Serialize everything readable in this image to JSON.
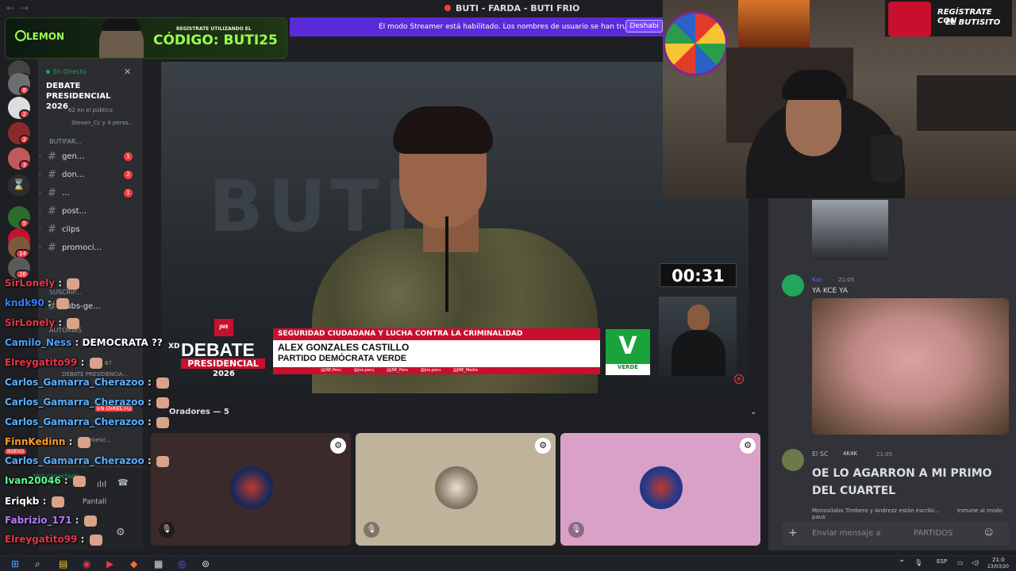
{
  "window": {
    "title": "BUTI - FARDA - BUTI FRIO"
  },
  "banner": {
    "brand": "LEMON",
    "small_text": "REGÍSTRATE UTILIZANDO EL",
    "code": "CÓDIGO: BUTI25"
  },
  "streamer_bar": {
    "text": "El modo Streamer está habilitado. Los nombres de usuario se han truncado.",
    "button": "Deshabi"
  },
  "servers": [
    {
      "badge": "4"
    },
    {
      "badge": "8"
    },
    {
      "badge": "2"
    },
    {
      "badge": "2"
    },
    {
      "badge": "3"
    },
    {
      "badge": ""
    },
    {
      "badge": "5"
    },
    {
      "badge": "4"
    },
    {
      "badge": "14"
    },
    {
      "badge": "26"
    }
  ],
  "sidebar": {
    "live_label": "En Directo",
    "event_title": "DEBATE PRESIDENCIAL 2026",
    "audience": "62 en el público",
    "friends": "Steven_Cc y 4 perso...",
    "category1": "BUTIFAR...",
    "channels": [
      {
        "name": "gen...",
        "count": "1"
      },
      {
        "name": "don...",
        "count": "2"
      },
      {
        "name": "...",
        "count": "1"
      },
      {
        "name": "post...",
        "count": ""
      },
      {
        "name": "clips",
        "count": ""
      },
      {
        "name": "promoci...",
        "count": ""
      }
    ],
    "category2": "SUSCRIP...",
    "channel_subs": "subs-ge...",
    "category3": "AUTORIAS",
    "stage_title": "DEBATE PRESIDENCIA...",
    "live_badge": "EN DIRECTO",
    "new_badge": "NUEVO",
    "voice_connected": "Voz conectada",
    "screen_btn": "Pantall",
    "stage_count": "67",
    "user_short": "onkelvi..."
  },
  "video": {
    "clock": "00:31",
    "topic": "SEGURIDAD CIUDADANA Y LUCHA CONTRA LA CRIMINALIDAD",
    "candidate": "ALEX GONZALES CASTILLO",
    "party": "PARTIDO DEMÓCRATA VERDE",
    "socials": "@JNE.Peru @jne.peru @JNE_Peru @jne.peru @JNE_Media",
    "logo_debate": "DEBATE",
    "logo_presidencial": "PRESIDENCIAL",
    "logo_year": "2026",
    "xd": "XD",
    "jne": "JNE",
    "party_letter": "V",
    "party_name": "VERDE",
    "bg_text": "BUTI1"
  },
  "speakers": {
    "header": "Oradores — 5"
  },
  "webcam": {
    "line1": "REGÍSTRATE CON",
    "line2": "EL BUTISITO"
  },
  "chat": {
    "msg1": {
      "name": "Kai",
      "time": "21:05",
      "text": "YA KCE YA"
    },
    "msg2": {
      "name": "El SC",
      "tag": "4K4K",
      "time": "21:05",
      "text": "OE LO AGARRON A MI PRIMO DEL CUARTEL"
    },
    "typing": "Monosilabo Timbero y Andrezz están escribi...",
    "notice": "Inmune al modo paus",
    "input_placeholder": "Enviar mensaje a",
    "input_channel": "PARTIDOS"
  },
  "overlay_chat": [
    {
      "user": "SirLonely",
      "msg": "",
      "color": "#e8344a"
    },
    {
      "user": "kndk90",
      "msg": "",
      "color": "#3a7bff"
    },
    {
      "user": "SirLonely",
      "msg": "",
      "color": "#e8344a"
    },
    {
      "user": "Camilo_Ness",
      "msg": "DEMOCRATA ??",
      "color": "#4aa0ff"
    },
    {
      "user": "Elreygatito99",
      "msg": "",
      "color": "#e8344a"
    },
    {
      "user": "Carlos_Gamarra_Cherazoo",
      "msg": "",
      "color": "#5ab0ff"
    },
    {
      "user": "Carlos_Gamarra_Cherazoo",
      "msg": "",
      "color": "#5ab0ff"
    },
    {
      "user": "Carlos_Gamarra_Cherazoo",
      "msg": "",
      "color": "#5ab0ff"
    },
    {
      "user": "FinnKedinn",
      "msg": "",
      "color": "#ff9a2a"
    },
    {
      "user": "Carlos_Gamarra_Cherazoo",
      "msg": "",
      "color": "#5ab0ff"
    },
    {
      "user": "Ivan20046",
      "msg": "",
      "color": "#5aff8a"
    },
    {
      "user": "Eriqkb",
      "msg": "",
      "color": "#ffffff"
    },
    {
      "user": "Fabrizio_171",
      "msg": "",
      "color": "#b57aff"
    },
    {
      "user": "Elreygatito99",
      "msg": "",
      "color": "#e8344a"
    }
  ],
  "taskbar": {
    "lang": "ESP",
    "time": "21:0",
    "date": "23/03/20"
  },
  "colors": {
    "accent": "#5a2bd8",
    "danger": "#f23f42",
    "online": "#23a55a"
  }
}
